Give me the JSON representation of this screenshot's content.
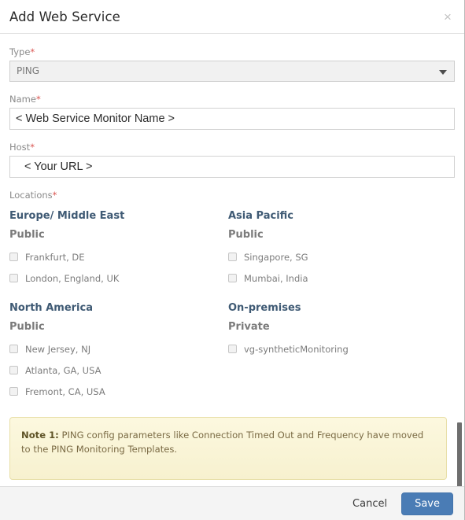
{
  "dialog": {
    "title": "Add Web Service",
    "close_icon": "close-icon",
    "close_glyph": "×"
  },
  "form": {
    "type": {
      "label": "Type",
      "required_marker": "*",
      "value": "PING",
      "options": [
        "PING"
      ]
    },
    "name": {
      "label": "Name",
      "required_marker": "*",
      "value": "< Web Service Monitor Name >",
      "placeholder": "< Web Service Monitor Name >"
    },
    "host": {
      "label": "Host",
      "required_marker": "*",
      "value": "< Your URL >",
      "placeholder": "< Your URL >"
    },
    "locations": {
      "label": "Locations",
      "required_marker": "*",
      "groups": [
        {
          "region": "Europe/ Middle East",
          "access": "Public",
          "items": [
            {
              "label": "Frankfurt, DE",
              "checked": false
            },
            {
              "label": "London, England, UK",
              "checked": false
            }
          ]
        },
        {
          "region": "Asia Pacific",
          "access": "Public",
          "items": [
            {
              "label": "Singapore, SG",
              "checked": false
            },
            {
              "label": "Mumbai, India",
              "checked": false
            }
          ]
        },
        {
          "region": "North America",
          "access": "Public",
          "items": [
            {
              "label": "New Jersey, NJ",
              "checked": false
            },
            {
              "label": "Atlanta, GA, USA",
              "checked": false
            },
            {
              "label": "Fremont, CA, USA",
              "checked": false
            }
          ]
        },
        {
          "region": "On-premises",
          "access": "Private",
          "items": [
            {
              "label": "vg-syntheticMonitoring",
              "checked": false
            }
          ]
        }
      ]
    }
  },
  "note": {
    "prefix": "Note 1:",
    "text": " PING config parameters like Connection Timed Out and Frequency have moved to the PING Monitoring Templates."
  },
  "footer": {
    "cancel_label": "Cancel",
    "save_label": "Save"
  },
  "colors": {
    "accent_blue": "#4a7cb5",
    "region_heading": "#3f5a74",
    "required_red": "#d9534f",
    "note_bg": "#fcf8df",
    "note_border": "#e8dfa8"
  }
}
